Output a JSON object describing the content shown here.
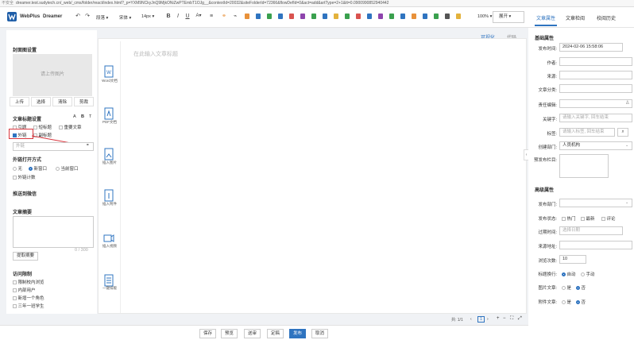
{
  "address": {
    "warning": "不安全",
    "url": "dreamer.test.sudytech.cn/_web/_cms/folder/react/index.html?_p=YXM9NCkyJnQ9MjkONiZwPTEmbT1OJg__&contextId=20032&siteFolderId=72366&flowDefId=0&act=add&artType=2+1&tt=0.0900990852940442"
  },
  "brand": {
    "name": "WebPlus",
    "product": "Dreamer"
  },
  "toolbar": {
    "paragraph": "段落",
    "font": "宋体",
    "size": "14px",
    "zoom": "100%",
    "expand": "展开",
    "undo_icon": "undo-icon",
    "redo_icon": "redo-icon",
    "bold": "B",
    "italic": "I",
    "underline": "U",
    "colors": {
      "orange": "#e8913a",
      "blue": "#2f74c0",
      "green": "#3aa04e",
      "purple": "#8e44ad",
      "red": "#d9534f",
      "yellow": "#e3b23c"
    }
  },
  "right_tabs": [
    "文章属性",
    "文章检阅",
    "校阅历史"
  ],
  "left": {
    "cover_title": "封面图设置",
    "upload_text": "请上传图片",
    "cover_buttons": [
      "上传",
      "选择",
      "清除",
      "剪裁"
    ],
    "title_settings": "文章标题设置",
    "title_opts": [
      "引题",
      "短标题",
      "重要文章",
      "外链",
      "副标题"
    ],
    "extlink_placeholder": "外链",
    "open_method": "外链打开方式",
    "open_opts": [
      "无",
      "新窗口",
      "当前窗口"
    ],
    "ext_count": "外链计数",
    "push_wechat": "推送到微信",
    "summary": "文章摘要",
    "summary_count": "0 / 300",
    "extract_summary": "提取摘要",
    "access_control": "访问限制",
    "access_opts": [
      "限制校内浏览",
      "内部用户",
      "新增一个角色",
      "三年一班学生"
    ]
  },
  "editor": {
    "tabs": [
      "可视化",
      "代码"
    ],
    "title_placeholder": "在此输入文章标题",
    "side_items": [
      "Word文档",
      "PDF文档",
      "插入图片",
      "插入附件",
      "插入视频",
      "一键排版"
    ],
    "pagination": "共: 1/1",
    "page_num": "1"
  },
  "bottom_buttons": [
    "保存",
    "预览",
    "送审",
    "定稿",
    "发布",
    "取消"
  ],
  "right": {
    "basic": "基础属性",
    "publish_time_label": "发布时间:",
    "publish_time": "2024-02-06 15:58:06",
    "author": "作者:",
    "source": "来源:",
    "category": "文章分类:",
    "editor": "责任编辑:",
    "keywords": "关键字:",
    "keywords_ph": "请输入关键字, 回车结束",
    "tags": "标签:",
    "tags_ph": "请输入标签, 回车结束",
    "dept": "创建部门:",
    "dept_val": "人员机构",
    "column": "预发布栏目:",
    "advanced": "高级属性",
    "pub_dept": "发布部门:",
    "pub_status": "发布状态:",
    "status_opts": [
      "热门",
      "最新",
      "评论"
    ],
    "expire": "过期时间:",
    "expire_ph": "选择日期",
    "source_url": "来源地址:",
    "views": "浏览次数:",
    "views_val": "10",
    "title_wrap": "标题换行:",
    "wrap_opts": [
      "自动",
      "手动"
    ],
    "image_article": "图片文章:",
    "attach_article": "附件文章:",
    "yes": "是",
    "no": "否"
  }
}
